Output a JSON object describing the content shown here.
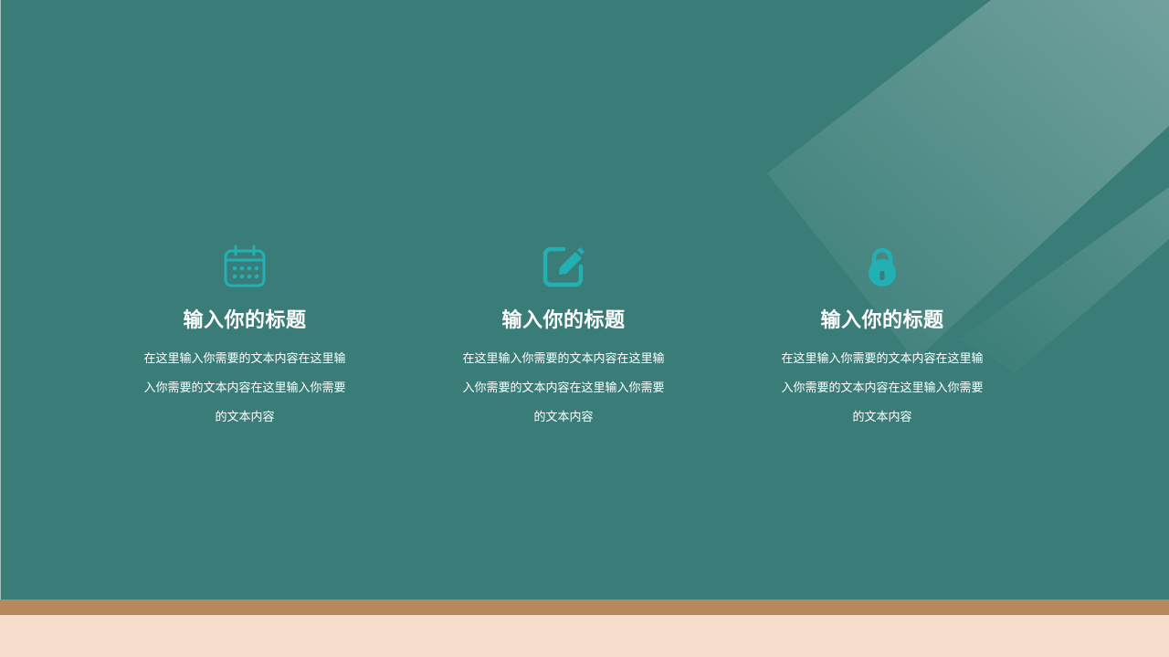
{
  "colors": {
    "background": "#3a7d78",
    "icon": "#22b0b4",
    "text": "#ffffff",
    "band_brown": "#b5885d",
    "band_peach": "#f6ddcc"
  },
  "features": [
    {
      "icon": "calendar-icon",
      "title": "输入你的标题",
      "body": "在这里输入你需要的文本内容在这里输入你需要的文本内容在这里输入你需要的文本内容"
    },
    {
      "icon": "edit-icon",
      "title": "输入你的标题",
      "body": "在这里输入你需要的文本内容在这里输入你需要的文本内容在这里输入你需要的文本内容"
    },
    {
      "icon": "lock-icon",
      "title": "输入你的标题",
      "body": "在这里输入你需要的文本内容在这里输入你需要的文本内容在这里输入你需要的文本内容"
    }
  ]
}
